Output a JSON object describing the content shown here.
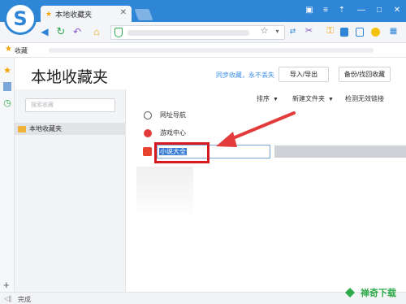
{
  "browser": {
    "tab_title": "本地收藏夹",
    "logo_letter": "S",
    "window_controls": [
      "▣",
      "≡",
      "⇡",
      "—",
      "□",
      "✕"
    ],
    "nav_icons": [
      "back-icon",
      "forward-icon",
      "refresh-icon",
      "undo-icon",
      "home-icon"
    ],
    "toolbar_icons": [
      "star-icon",
      "dropdown-icon",
      "scissors-icon",
      "key-icon",
      "reader-icon",
      "sidebar-icon",
      "emoji-icon",
      "grid-icon"
    ]
  },
  "bookmark_bar": {
    "label": "收藏"
  },
  "page": {
    "title": "本地收藏夹",
    "sync_text": "同步收藏，永不丢失",
    "import_export_label": "导入/导出",
    "backup_restore_label": "备份/找回收藏"
  },
  "sidebar": {
    "search_placeholder": "搜索收藏",
    "folders": [
      {
        "label": "本地收藏夹"
      }
    ]
  },
  "list_toolbar": {
    "sort_label": "排序",
    "new_folder_label": "新建文件夹",
    "check_label": "检测无效链接"
  },
  "bookmarks": [
    {
      "label": "网址导航",
      "icon": "globe-icon"
    },
    {
      "label": "游戏中心",
      "icon": "game-icon"
    }
  ],
  "editing_item": {
    "value": "小说大全",
    "icon": "book-icon"
  },
  "status": {
    "text": "完成"
  },
  "watermark": {
    "text": "禅奇下载"
  },
  "colors": {
    "accent": "#2f86d6",
    "highlight_box": "#d71920",
    "arrow": "#e33b3b",
    "folder": "#f0b33a",
    "sync_link": "#3a8ee6"
  }
}
